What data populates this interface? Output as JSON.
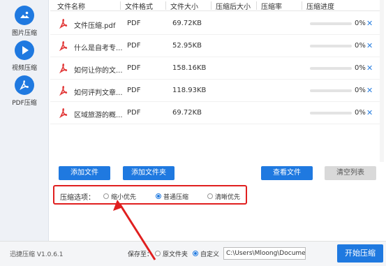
{
  "sidebar": {
    "items": [
      {
        "label": "图片压缩",
        "icon": "image-icon"
      },
      {
        "label": "视频压缩",
        "icon": "play-icon"
      },
      {
        "label": "PDF压缩",
        "icon": "pdf-icon",
        "active": true
      }
    ]
  },
  "table": {
    "headers": [
      "文件名称",
      "文件格式",
      "文件大小",
      "压缩后大小",
      "压缩率",
      "压缩进度"
    ],
    "rows": [
      {
        "name": "文件压缩.pdf",
        "format": "PDF",
        "size": "69.72KB",
        "progress": 0,
        "pct": "0%"
      },
      {
        "name": "什么是自考专...",
        "format": "PDF",
        "size": "52.95KB",
        "progress": 0,
        "pct": "0%"
      },
      {
        "name": "如何让你的文...",
        "format": "PDF",
        "size": "158.16KB",
        "progress": 0,
        "pct": "0%"
      },
      {
        "name": "如何评判文章...",
        "format": "PDF",
        "size": "118.93KB",
        "progress": 0,
        "pct": "0%"
      },
      {
        "name": "区域旅游的概...",
        "format": "PDF",
        "size": "69.72KB",
        "progress": 0,
        "pct": "0%"
      }
    ],
    "delete_glyph": "✕"
  },
  "buttons": {
    "add_file": "添加文件",
    "add_folder": "添加文件夹",
    "view_file": "查看文件",
    "clear_list": "清空列表"
  },
  "options": {
    "label": "压缩选项：",
    "choices": [
      "缩小优先",
      "普通压缩",
      "清晰优先"
    ],
    "selected": 1
  },
  "bottom": {
    "version": "迅捷压缩 V1.0.6.1",
    "save_label": "保存至：",
    "save_choices": [
      "原文件夹",
      "自定义"
    ],
    "save_selected": 1,
    "path": "C:\\Users\\Mloong\\Documen",
    "start": "开始压缩"
  },
  "colors": {
    "accent": "#1f79e0",
    "highlight": "#e01f1f",
    "pdf": "#e23b3b"
  }
}
